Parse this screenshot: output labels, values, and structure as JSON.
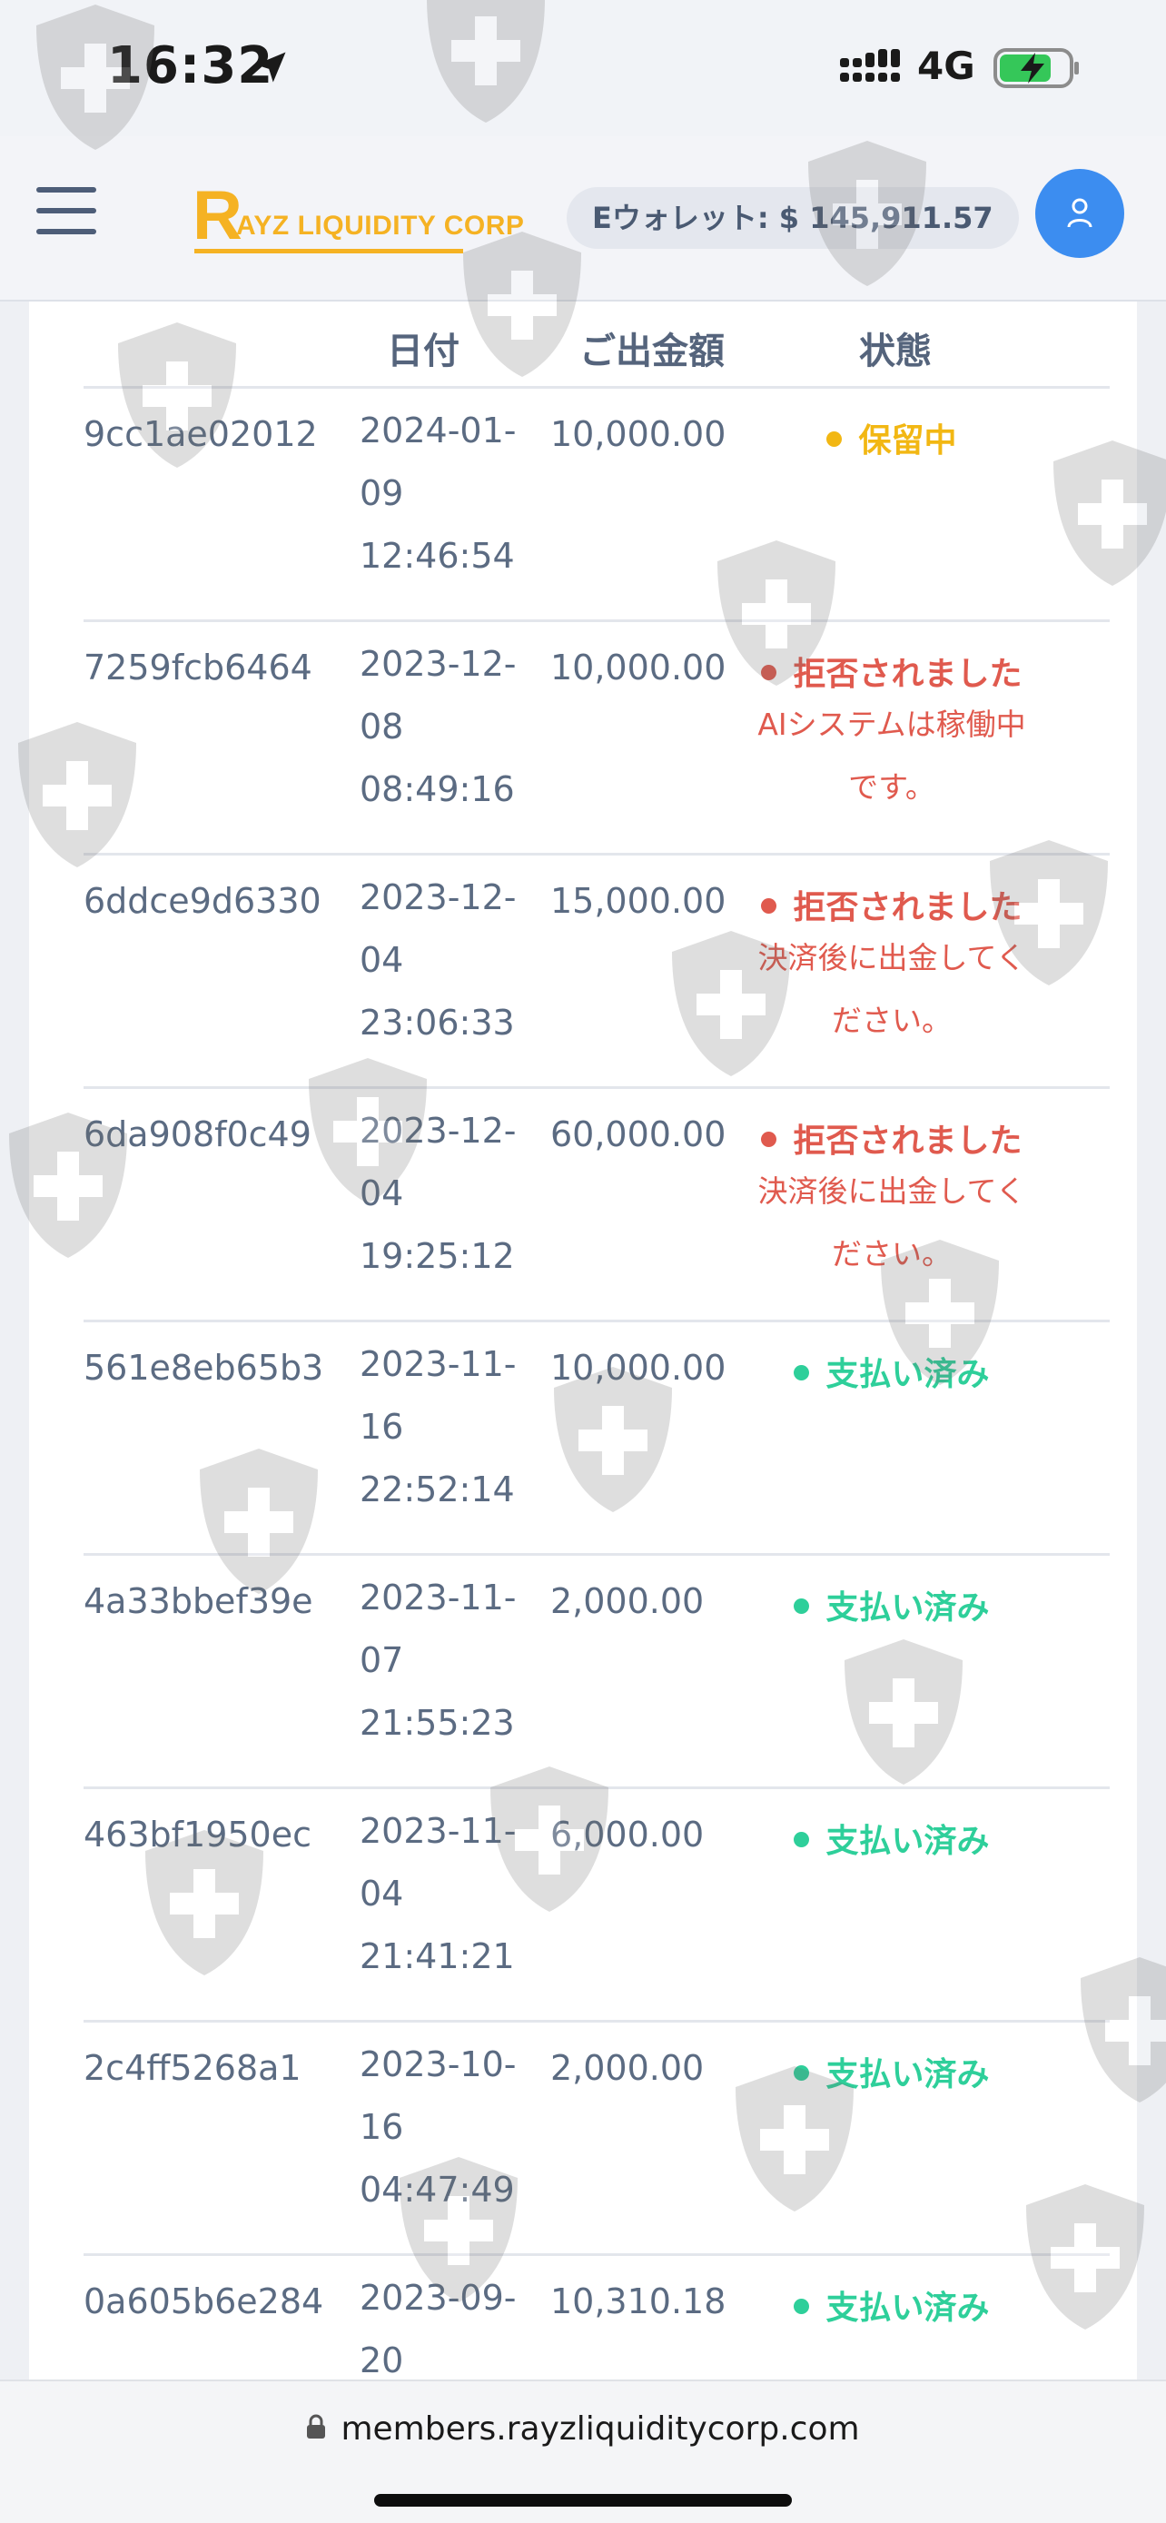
{
  "status_bar": {
    "time": "16:32",
    "network": "4G",
    "location_icon": "location-arrow-icon",
    "signal_icon": "signal-icon",
    "battery_icon": "battery-charging-icon"
  },
  "header": {
    "logo_initial": "R",
    "logo_text": "AYZ LIQUIDITY CORP",
    "wallet_label": "Eウォレット: $ 145,911.57",
    "brand_color": "#f5b223",
    "accent_color": "#3c8df0"
  },
  "table": {
    "columns": [
      "日付",
      "ご出金額",
      "状態"
    ],
    "rows": [
      {
        "id": "9cc1ae02012",
        "date": "2024-01-09 12:46:54",
        "amount": "10,000.00",
        "status": "保留中",
        "status_type": "pending",
        "note": ""
      },
      {
        "id": "7259fcb6464",
        "date": "2023-12-08 08:49:16",
        "amount": "10,000.00",
        "status": "拒否されました",
        "status_type": "rejected",
        "note": "AIシステムは稼働中です。"
      },
      {
        "id": "6ddce9d6330",
        "date": "2023-12-04 23:06:33",
        "amount": "15,000.00",
        "status": "拒否されました",
        "status_type": "rejected",
        "note": "決済後に出金してください。"
      },
      {
        "id": "6da908f0c49",
        "date": "2023-12-04 19:25:12",
        "amount": "60,000.00",
        "status": "拒否されました",
        "status_type": "rejected",
        "note": "決済後に出金してください。"
      },
      {
        "id": "561e8eb65b3",
        "date": "2023-11-16 22:52:14",
        "amount": "10,000.00",
        "status": "支払い済み",
        "status_type": "paid",
        "note": ""
      },
      {
        "id": "4a33bbef39e",
        "date": "2023-11-07 21:55:23",
        "amount": "2,000.00",
        "status": "支払い済み",
        "status_type": "paid",
        "note": ""
      },
      {
        "id": "463bf1950ec",
        "date": "2023-11-04 21:41:21",
        "amount": "6,000.00",
        "status": "支払い済み",
        "status_type": "paid",
        "note": ""
      },
      {
        "id": "2c4ff5268a1",
        "date": "2023-10-16 04:47:49",
        "amount": "2,000.00",
        "status": "支払い済み",
        "status_type": "paid",
        "note": ""
      },
      {
        "id": "0a605b6e284",
        "date": "2023-09-20",
        "amount": "10,310.18",
        "status": "支払い済み",
        "status_type": "paid",
        "note": ""
      }
    ]
  },
  "url_bar": {
    "url": "members.rayzliquiditycorp.com"
  },
  "watermark_icon": "shield-plus-icon"
}
